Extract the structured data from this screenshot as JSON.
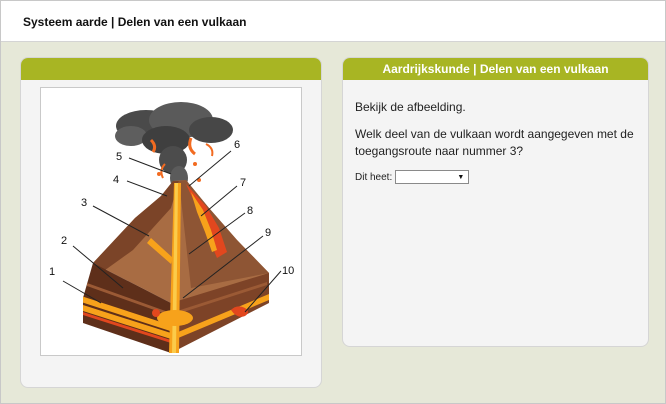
{
  "header": {
    "title": "Systeem aarde | Delen van een vulkaan"
  },
  "question_panel": {
    "title": "Aardrijkskunde | Delen van een vulkaan",
    "intro": "Bekijk de afbeelding.",
    "question": "Welk deel van de vulkaan wordt aangegeven met de toegangsroute naar nummer 3?",
    "answer_label": "Dit heet:",
    "answer_value": "",
    "dropdown_icon": "triangle-down"
  },
  "figure": {
    "numbers": [
      "1",
      "2",
      "3",
      "4",
      "5",
      "6",
      "7",
      "8",
      "9",
      "10"
    ],
    "colors": {
      "lava": "#f7a21b",
      "magma": "#e2471e",
      "rock_dark": "#6e3a22",
      "rock_light": "#a86c43",
      "smoke": "#555555"
    }
  }
}
